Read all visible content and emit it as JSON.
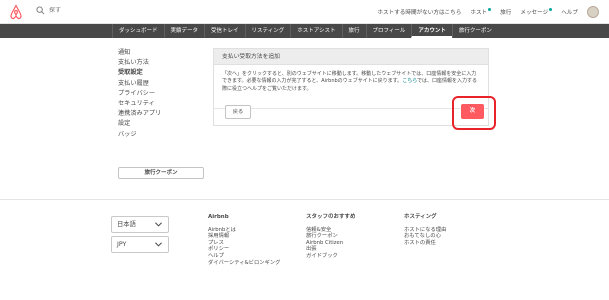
{
  "header": {
    "search_placeholder": "探す",
    "links": [
      {
        "label": "ホストする時間がない方はこちら",
        "dot": false
      },
      {
        "label": "ホスト",
        "dot": true
      },
      {
        "label": "旅行",
        "dot": false
      },
      {
        "label": "メッセージ",
        "dot": true
      },
      {
        "label": "ヘルプ",
        "dot": false
      }
    ]
  },
  "nav": {
    "tabs": [
      "ダッシュボード",
      "実績データ",
      "受信トレイ",
      "リスティング",
      "ホストアシスト",
      "旅行",
      "プロフィール",
      "アカウント",
      "旅行クーポン"
    ],
    "active_index": 7
  },
  "sidebar": {
    "items": [
      "通知",
      "支払い方法",
      "受取設定",
      "支払い履歴",
      "プライバシー",
      "セキュリティ",
      "連携済みアプリ",
      "設定",
      "バッジ"
    ],
    "active_index": 2,
    "coupon_button": "旅行クーポン"
  },
  "panel": {
    "title": "支払い受取方法を追加",
    "body_before_link": "「次へ」をクリックすると、別のウェブサイトに移動します。移動したウェブサイトでは、口座情報を安全に入力できます。必要な情報の入力が完了すると、Airbnbのウェブサイトに戻ります。",
    "link": "こちら",
    "body_after_link": "では、口座情報を入力する際に役立つヘルプをご覧いただけます。",
    "back_label": "戻る",
    "next_label": "次"
  },
  "footer": {
    "language": "日本語",
    "currency": "JPY",
    "columns": [
      {
        "title": "Airbnb",
        "links": [
          "Airbnbとは",
          "採用情報",
          "プレス",
          "ポリシー",
          "ヘルプ",
          "ダイバーシティ&ビロンギング"
        ]
      },
      {
        "title": "スタッフのおすすめ",
        "links": [
          "信頼&安全",
          "旅行クーポン",
          "Airbnb Citizen",
          "出張",
          "ガイドブック"
        ]
      },
      {
        "title": "ホスティング",
        "links": [
          "ホストになる理由",
          "おもてなしの心",
          "ホストの責任"
        ]
      }
    ]
  },
  "colors": {
    "brand": "#ff5a5f",
    "highlight": "#e8242a",
    "link": "#008489",
    "nav_bg": "#484848"
  }
}
